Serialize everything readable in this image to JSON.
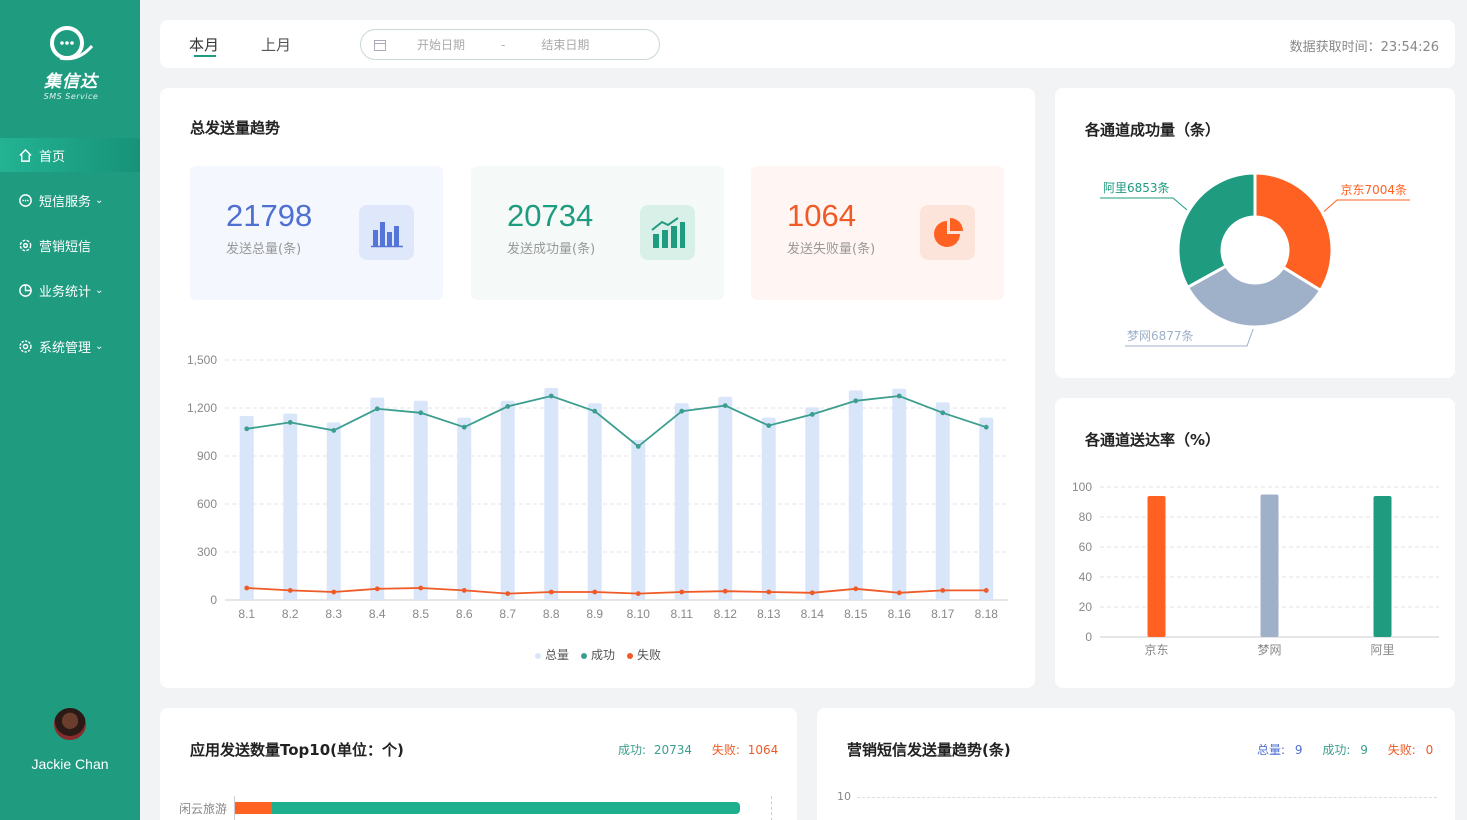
{
  "brand": {
    "name": "集信达",
    "sub": "SMS Service"
  },
  "nav": [
    {
      "label": "首页",
      "icon": "home-icon",
      "active": true,
      "has_children": false
    },
    {
      "label": "短信服务",
      "icon": "message-icon",
      "has_children": true
    },
    {
      "label": "营销短信",
      "icon": "gear-icon",
      "has_children": false
    },
    {
      "label": "业务统计",
      "icon": "chart-pie-icon",
      "has_children": true
    },
    {
      "label": "系统管理",
      "icon": "settings-icon",
      "has_children": true
    }
  ],
  "user": {
    "name": "Jackie Chan"
  },
  "topbar": {
    "tab_current": "本月",
    "tab_last": "上月",
    "date_start_placeholder": "开始日期",
    "date_sep": "-",
    "date_end_placeholder": "结束日期",
    "fetch_time": "数据获取时间：23:54:26"
  },
  "trend": {
    "title": "总发送量趋势",
    "stats": [
      {
        "value": "21798",
        "label": "发送总量(条)",
        "color": "#4f6fd1"
      },
      {
        "value": "20734",
        "label": "发送成功量(条)",
        "color": "#1f9b80"
      },
      {
        "value": "1064",
        "label": "发送失败量(条)",
        "color": "#ef5a26"
      }
    ]
  },
  "pie_card": {
    "title": "各通道成功量（条）"
  },
  "rate_card": {
    "title": "各通道送达率（%）"
  },
  "app_card": {
    "title": "应用发送数量Top10(单位：个)",
    "success_label": "成功:",
    "success_value": "20734",
    "fail_label": "失败:",
    "fail_value": "1064",
    "first_row_label": "闲云旅游"
  },
  "mkt_card": {
    "title": "营销短信发送量趋势(条)",
    "total_label": "总量:",
    "total_value": "9",
    "success_label": "成功:",
    "success_value": "9",
    "fail_label": "失败:",
    "fail_value": "0",
    "y_top": "10"
  },
  "colors": {
    "accent": "#1f9b80",
    "success": "#3c9e8e",
    "fail": "#ef5a26",
    "total_bar": "#d9e6fa",
    "grey_blue": "#9fb0c9"
  },
  "chart_data": [
    {
      "type": "bar",
      "categories": [
        "8.1",
        "8.2",
        "8.3",
        "8.4",
        "8.5",
        "8.6",
        "8.7",
        "8.8",
        "8.9",
        "8.10",
        "8.11",
        "8.12",
        "8.13",
        "8.14",
        "8.15",
        "8.16",
        "8.17",
        "8.18"
      ],
      "series": [
        {
          "name": "总量",
          "type": "bar",
          "values": [
            1150,
            1165,
            1110,
            1265,
            1245,
            1140,
            1245,
            1325,
            1230,
            1000,
            1230,
            1270,
            1140,
            1205,
            1310,
            1320,
            1235,
            1140
          ]
        },
        {
          "name": "成功",
          "type": "line",
          "values": [
            1070,
            1110,
            1060,
            1195,
            1170,
            1080,
            1210,
            1275,
            1180,
            960,
            1180,
            1215,
            1090,
            1160,
            1245,
            1275,
            1170,
            1080
          ]
        },
        {
          "name": "失败",
          "type": "line",
          "values": [
            75,
            60,
            50,
            70,
            75,
            60,
            40,
            50,
            50,
            40,
            50,
            55,
            50,
            45,
            70,
            45,
            60,
            60
          ]
        }
      ],
      "ylim": [
        0,
        1500
      ],
      "yticks": [
        "0",
        "300",
        "600",
        "900",
        "1,200",
        "1,500"
      ],
      "legend": "bottom"
    },
    {
      "type": "pie",
      "labels": [
        "京东7004条",
        "梦网6877条",
        "阿里6853条"
      ],
      "values": [
        7004,
        6877,
        6853
      ],
      "colors": [
        "#ff6122",
        "#9fb0c9",
        "#1f9b80"
      ]
    },
    {
      "type": "bar",
      "categories": [
        "京东",
        "梦网",
        "阿里"
      ],
      "values": [
        94,
        95,
        94
      ],
      "colors": [
        "#ff6122",
        "#9fb0c9",
        "#1f9b80"
      ],
      "ylim": [
        0,
        100
      ],
      "yticks": [
        "0",
        "20",
        "40",
        "60",
        "80",
        "100"
      ]
    }
  ]
}
